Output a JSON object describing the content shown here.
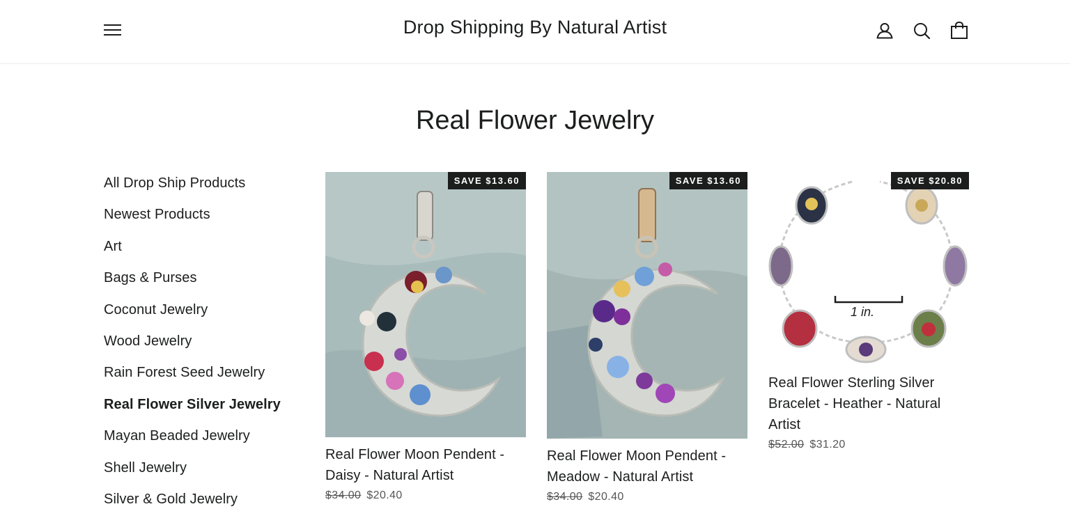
{
  "header": {
    "site_title": "Drop Shipping By Natural Artist",
    "icons": [
      "menu-icon",
      "account-icon",
      "search-icon",
      "cart-icon"
    ]
  },
  "page": {
    "title": "Real Flower Jewelry"
  },
  "sidebar": {
    "items": [
      {
        "label": "All Drop Ship Products",
        "active": false
      },
      {
        "label": "Newest Products",
        "active": false
      },
      {
        "label": "Art",
        "active": false
      },
      {
        "label": "Bags & Purses",
        "active": false
      },
      {
        "label": "Coconut Jewelry",
        "active": false
      },
      {
        "label": "Wood Jewelry",
        "active": false
      },
      {
        "label": "Rain Forest Seed Jewelry",
        "active": false
      },
      {
        "label": "Real Flower Silver Jewelry",
        "active": true
      },
      {
        "label": "Mayan Beaded Jewelry",
        "active": false
      },
      {
        "label": "Shell Jewelry",
        "active": false
      },
      {
        "label": "Silver & Gold Jewelry",
        "active": false
      }
    ]
  },
  "products": [
    {
      "badge": "SAVE $13.60",
      "title": "Real Flower Moon Pendent - Daisy - Natural Artist",
      "was_price": "$34.00",
      "price": "$20.40"
    },
    {
      "badge": "SAVE $13.60",
      "title": "Real Flower Moon Pendent - Meadow - Natural Artist",
      "was_price": "$34.00",
      "price": "$20.40"
    },
    {
      "badge": "SAVE $20.80",
      "title": "Real Flower Sterling Silver Bracelet - Heather - Natural Artist",
      "was_price": "$52.00",
      "price": "$31.20",
      "image_text": "1 in."
    }
  ]
}
